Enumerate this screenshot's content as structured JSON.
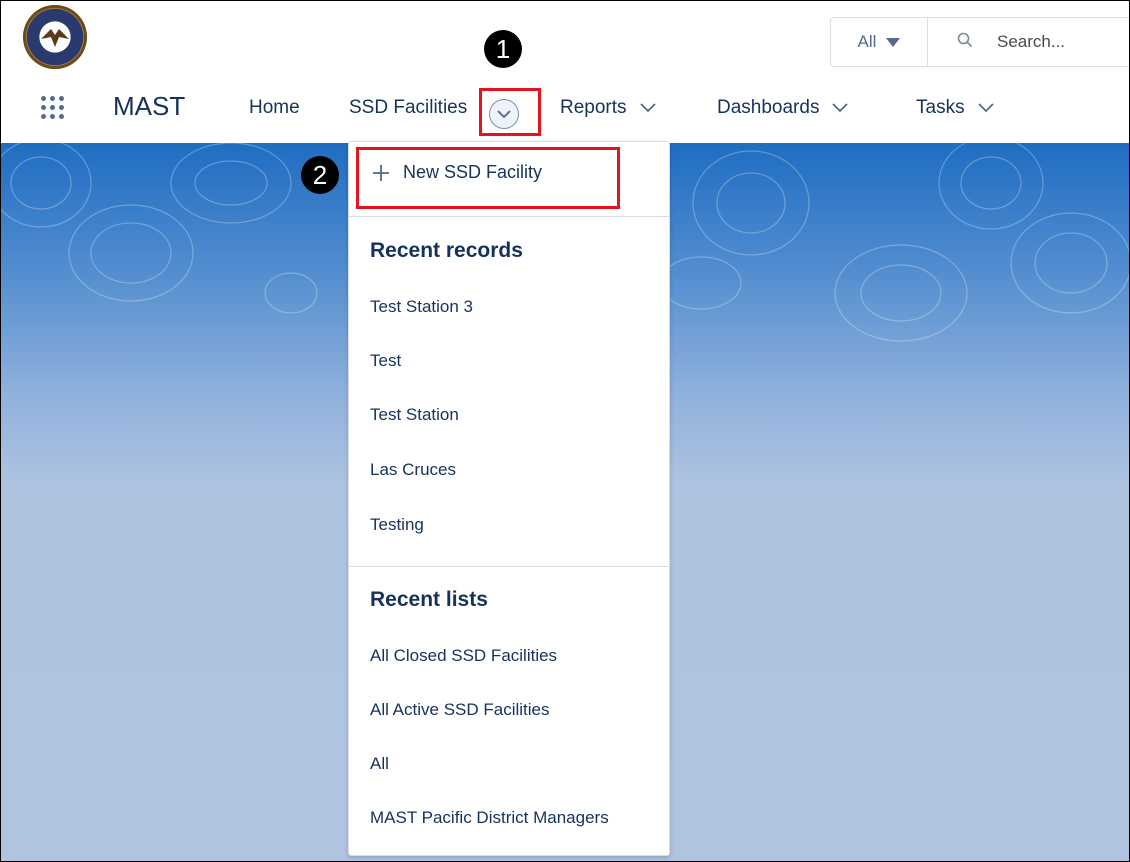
{
  "header": {
    "app_name": "MAST",
    "search": {
      "scope": "All",
      "placeholder": "Search..."
    },
    "nav": [
      {
        "label": "Home"
      },
      {
        "label": "SSD Facilities"
      },
      {
        "label": "Reports"
      },
      {
        "label": "Dashboards"
      },
      {
        "label": "Tasks"
      }
    ]
  },
  "annotations": {
    "step1": "1",
    "step2": "2",
    "highlight_color": "#e4131e"
  },
  "menu": {
    "new_action": "New SSD Facility",
    "recent_records_title": "Recent records",
    "recent_records": [
      "Test Station 3",
      "Test",
      "Test Station",
      "Las Cruces",
      "Testing"
    ],
    "recent_lists_title": "Recent lists",
    "recent_lists": [
      "All Closed SSD Facilities",
      "All Active SSD Facilities",
      "All",
      "MAST Pacific District Managers"
    ]
  },
  "colors": {
    "brand_blue": "#1f6dc2",
    "text": "#16325c"
  },
  "icons": [
    "seal-logo",
    "app-launcher-icon",
    "search-icon",
    "chevron-down-icon",
    "plus-icon"
  ]
}
